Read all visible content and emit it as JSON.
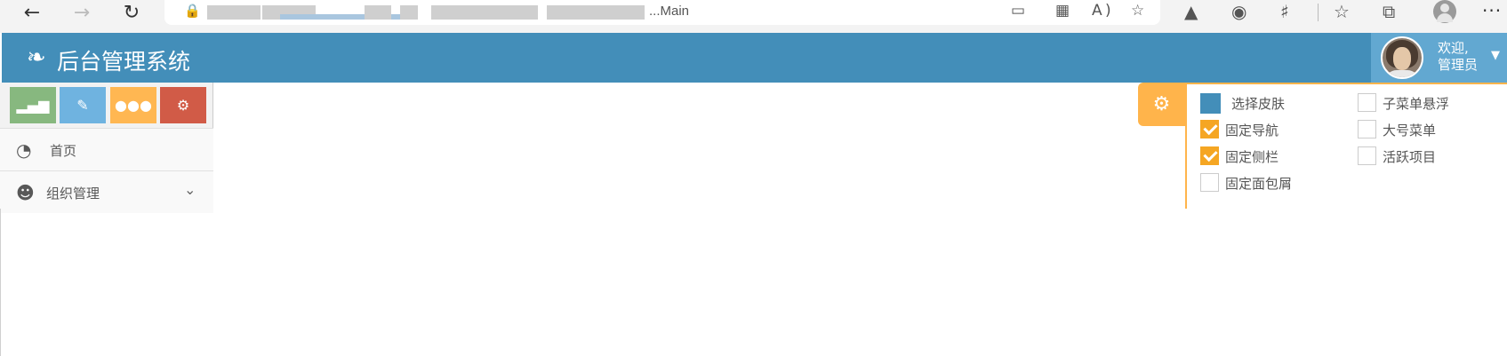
{
  "browser": {
    "back_icon": "back-arrow-icon",
    "forward_icon": "forward-arrow-icon",
    "refresh_icon": "refresh-icon",
    "url_visible": "...Main",
    "toolbar_icons": [
      "device-icon",
      "apps-icon",
      "read-aloud-icon",
      "favorite-add-icon",
      "extension-icon",
      "extension-icon",
      "puzzle-icon",
      "favorites-icon",
      "collections-icon",
      "profile-icon",
      "more-icon"
    ]
  },
  "header": {
    "logo_icon": "leaf-icon",
    "title": "后台管理系统",
    "background": "#438eb9",
    "user": {
      "welcome_line1": "欢迎,",
      "welcome_line2": "管理员"
    }
  },
  "sidebar": {
    "shortcuts": [
      {
        "icon": "signal-icon",
        "color": "#87b87f"
      },
      {
        "icon": "pencil-icon",
        "color": "#6fb3e0"
      },
      {
        "icon": "users-icon",
        "color": "#ffb752"
      },
      {
        "icon": "cogs-icon",
        "color": "#d15b47"
      }
    ],
    "items": [
      {
        "label": "首页",
        "icon": "dashboard-icon"
      },
      {
        "label": "组织管理",
        "icon": "users-icon",
        "has_submenu": true
      }
    ]
  },
  "settings": {
    "toggle_icon": "gear-icon",
    "accent": "#ffb44b",
    "skin": {
      "label": "选择皮肤",
      "color": "#438eb9"
    },
    "options": [
      {
        "label": "固定导航",
        "checked": true
      },
      {
        "label": "固定侧栏",
        "checked": true
      },
      {
        "label": "固定面包屑",
        "checked": false
      },
      {
        "label": "子菜单悬浮",
        "checked": false
      },
      {
        "label": "大号菜单",
        "checked": false
      },
      {
        "label": "活跃项目",
        "checked": false
      }
    ]
  }
}
